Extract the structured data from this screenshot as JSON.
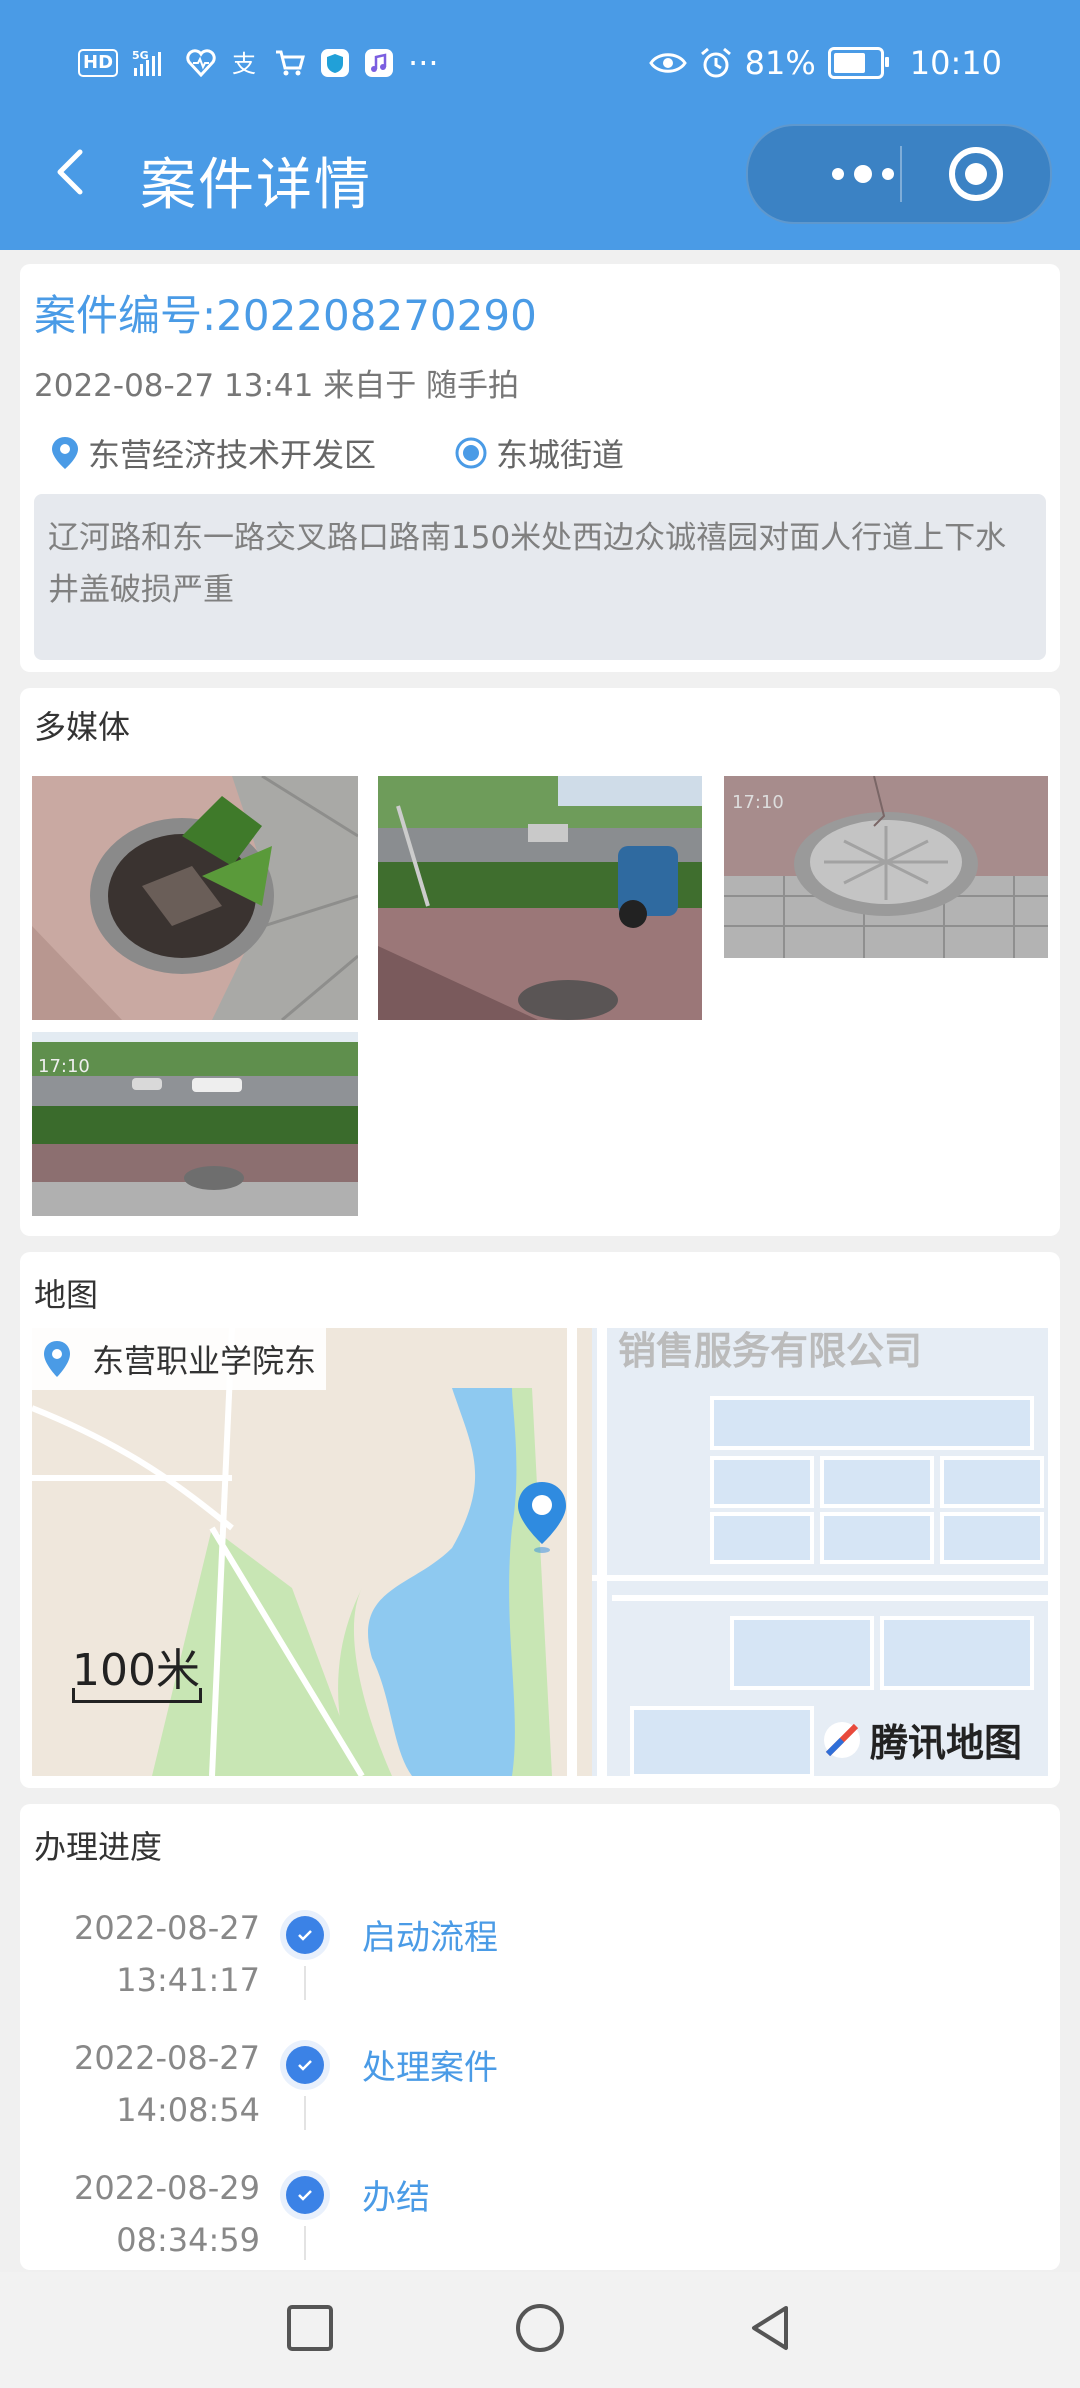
{
  "status_bar": {
    "hd_badge": "HD",
    "network": "5G",
    "battery_percent": "81%",
    "battery_level": 0.81,
    "time": "10:10",
    "more_icons": "···"
  },
  "nav": {
    "title": "案件详情",
    "back_icon": "chevron-left-icon",
    "menu_icon": "more-dots-icon",
    "close_icon": "target-circle-icon"
  },
  "case": {
    "number_text": "案件编号:202208270290",
    "meta_text": "2022-08-27 13:41 来自于 随手拍",
    "district": "东营经济技术开发区",
    "street": "东城街道",
    "description": "辽河路和东一路交叉路口路南150米处西边众诚禧园对面人行道上下水井盖破损严重"
  },
  "media": {
    "title": "多媒体",
    "photos": [
      {
        "name": "damaged-manhole-photo",
        "caption": ""
      },
      {
        "name": "sidewalk-scooter-photo",
        "caption": ""
      },
      {
        "name": "manhole-cover-photo",
        "caption": "17:10"
      },
      {
        "name": "roadside-manhole-photo",
        "caption": "17:10"
      }
    ]
  },
  "map": {
    "title": "地图",
    "location_label": "东营职业学院东",
    "scale_label": "100米",
    "logo_text": "腾讯地图",
    "bg_text": "销售服务有限公司"
  },
  "progress": {
    "title": "办理进度",
    "steps": [
      {
        "date": "2022-08-27",
        "time": "13:41:17",
        "label": "启动流程"
      },
      {
        "date": "2022-08-27",
        "time": "14:08:54",
        "label": "处理案件"
      },
      {
        "date": "2022-08-29",
        "time": "08:34:59",
        "label": "办结"
      }
    ]
  },
  "colors": {
    "header": "#4a9be6",
    "accent": "#4a9be6",
    "check": "#3b82e6"
  }
}
